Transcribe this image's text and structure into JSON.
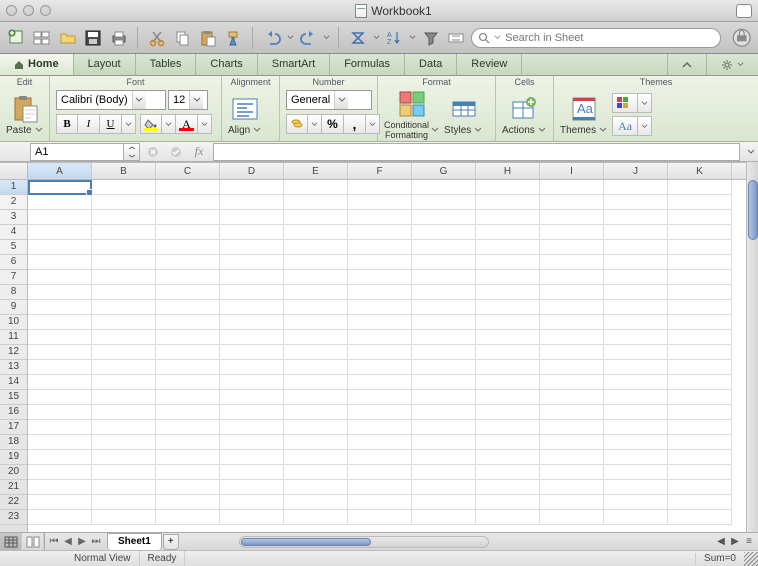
{
  "window": {
    "title": "Workbook1"
  },
  "search": {
    "placeholder": "Search in Sheet"
  },
  "tabs": {
    "items": [
      "Home",
      "Layout",
      "Tables",
      "Charts",
      "SmartArt",
      "Formulas",
      "Data",
      "Review"
    ],
    "active_index": 0
  },
  "ribbon": {
    "edit": {
      "title": "Edit",
      "paste": "Paste"
    },
    "font": {
      "title": "Font",
      "name": "Calibri (Body)",
      "size": "12",
      "bold": "B",
      "italic": "I",
      "underline": "U",
      "fill_color": "#ffff00",
      "text_color": "#ff0000",
      "font_letter": "A"
    },
    "alignment": {
      "title": "Alignment",
      "align": "Align"
    },
    "number": {
      "title": "Number",
      "format": "General"
    },
    "format": {
      "title": "Format",
      "conditional": "Conditional\nFormatting",
      "styles": "Styles"
    },
    "cells": {
      "title": "Cells",
      "actions": "Actions"
    },
    "themes": {
      "title": "Themes",
      "themes": "Themes",
      "aa": "Aa"
    }
  },
  "namebox": {
    "value": "A1"
  },
  "columns": [
    "A",
    "B",
    "C",
    "D",
    "E",
    "F",
    "G",
    "H",
    "I",
    "J",
    "K"
  ],
  "rows": [
    "1",
    "2",
    "3",
    "4",
    "5",
    "6",
    "7",
    "8",
    "9",
    "10",
    "11",
    "12",
    "13",
    "14",
    "15",
    "16",
    "17",
    "18",
    "19",
    "20",
    "21",
    "22",
    "23"
  ],
  "selected_col_index": 0,
  "selected_row_index": 0,
  "sheet": {
    "name": "Sheet1"
  },
  "status": {
    "view": "Normal View",
    "state": "Ready",
    "sum": "Sum=0"
  }
}
